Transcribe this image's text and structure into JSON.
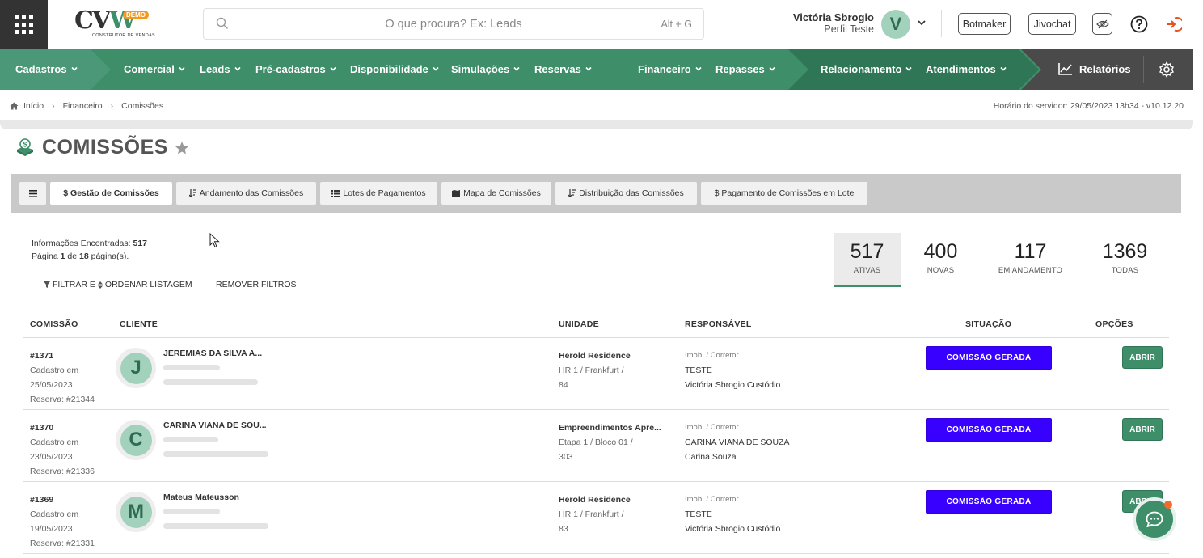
{
  "header": {
    "logo": {
      "text_main": "CV",
      "text_tail": "CO",
      "badge": "DEMO",
      "subtitle": "CONSTRUTOR DE VENDAS"
    },
    "search": {
      "placeholder": "O que procura? Ex: Leads",
      "shortcut": "Alt + G"
    },
    "user": {
      "name": "Victória Sbrogio",
      "profile": "Perfil Teste",
      "initial": "V"
    },
    "buttons": {
      "botmaker": "Botmaker",
      "jivochat": "Jivochat"
    }
  },
  "nav": {
    "items": [
      {
        "label": "Cadastros"
      },
      {
        "label": "Comercial"
      },
      {
        "label": "Leads"
      },
      {
        "label": "Pré-cadastros"
      },
      {
        "label": "Disponibilidade"
      },
      {
        "label": "Simulações"
      },
      {
        "label": "Reservas"
      },
      {
        "label": "Financeiro"
      },
      {
        "label": "Repasses"
      },
      {
        "label": "Relacionamento"
      },
      {
        "label": "Atendimentos"
      }
    ],
    "reports": "Relatórios"
  },
  "breadcrumb": {
    "home": "Início",
    "level1": "Financeiro",
    "level2": "Comissões"
  },
  "server_time": "Horário do servidor: 29/05/2023 13h34 - v10.12.20",
  "page": {
    "title": "COMISSÕES"
  },
  "tabs": [
    {
      "label": "$ Gestão de Comissões"
    },
    {
      "label": "Andamento das Comissões"
    },
    {
      "label": "Lotes de Pagamentos"
    },
    {
      "label": "Mapa de Comissões"
    },
    {
      "label": "Distribuição das Comissões"
    },
    {
      "label": "$ Pagamento de Comissões em Lote"
    }
  ],
  "info": {
    "found_label": "Informações Encontradas:",
    "found_count": "517",
    "page_label": "Página",
    "page_current": "1",
    "page_of": "de",
    "page_total": "18",
    "page_suffix": "página(s)."
  },
  "filters": {
    "filter_label": "FILTRAR E",
    "order_label": "ORDENAR LISTAGEM",
    "remove_label": "REMOVER FILTROS"
  },
  "stats": [
    {
      "value": "517",
      "label": "ATIVAS"
    },
    {
      "value": "400",
      "label": "NOVAS"
    },
    {
      "value": "117",
      "label": "EM ANDAMENTO"
    },
    {
      "value": "1369",
      "label": "TODAS"
    }
  ],
  "table": {
    "headers": {
      "id": "COMISSÃO",
      "client": "CLIENTE",
      "unit": "UNIDADE",
      "resp": "RESPONSÁVEL",
      "status": "SITUAÇÃO",
      "options": "OPÇÕES"
    },
    "rows": [
      {
        "id": "#1371",
        "created_label": "Cadastro em",
        "created": "25/05/2023",
        "reserva": "Reserva: #21344",
        "initial": "J",
        "client": "JEREMIAS DA SILVA A...",
        "unit_name": "Herold Residence",
        "unit_line2": "HR 1 / Frankfurt /",
        "unit_line3": "84",
        "role": "Imob. / Corretor",
        "resp1": "TESTE",
        "resp2": "Victória Sbrogio Custódio",
        "status": "COMISSÃO GERADA",
        "action": "ABRIR"
      },
      {
        "id": "#1370",
        "created_label": "Cadastro em",
        "created": "23/05/2023",
        "reserva": "Reserva: #21336",
        "initial": "C",
        "client": "CARINA VIANA DE SOU...",
        "unit_name": "Empreendimentos Apre...",
        "unit_line2": "Etapa 1 / Bloco 01 /",
        "unit_line3": "303",
        "role": "Imob. / Corretor",
        "resp1": "CARINA VIANA DE SOUZA",
        "resp2": "Carina Souza",
        "status": "COMISSÃO GERADA",
        "action": "ABRIR"
      },
      {
        "id": "#1369",
        "created_label": "Cadastro em",
        "created": "19/05/2023",
        "reserva": "Reserva: #21331",
        "initial": "M",
        "client": "Mateus Mateusson",
        "unit_name": "Herold Residence",
        "unit_line2": "HR 1 / Frankfurt /",
        "unit_line3": "83",
        "role": "Imob. / Corretor",
        "resp1": "TESTE",
        "resp2": "Victória Sbrogio Custódio",
        "status": "COMISSÃO GERADA",
        "action": "ABRIR"
      }
    ]
  },
  "colors": {
    "brand_green": "#3e8e6a",
    "status_blue": "#3700ff",
    "notification": "#f26b2a"
  }
}
